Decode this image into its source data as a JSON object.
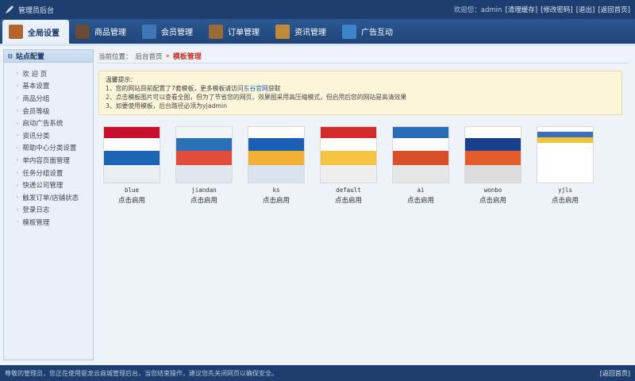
{
  "topbar": {
    "app_title": "管理员后台",
    "welcome": "欢迎您：admin",
    "links": [
      "[清理缓存]",
      "[修改密码]",
      "[退出]",
      "[返回首页]"
    ]
  },
  "nav": {
    "items": [
      {
        "label": "全局设置",
        "icon": "gear-house-icon",
        "color": "#b5642c",
        "active": true
      },
      {
        "label": "商品管理",
        "icon": "box-icon",
        "color": "#6b4a34"
      },
      {
        "label": "会员管理",
        "icon": "user-card-icon",
        "color": "#3c78b5"
      },
      {
        "label": "订单管理",
        "icon": "order-icon",
        "color": "#9b6a37"
      },
      {
        "label": "资讯管理",
        "icon": "news-icon",
        "color": "#c08a3a"
      },
      {
        "label": "广告互动",
        "icon": "ad-icon",
        "color": "#3f83c8"
      }
    ]
  },
  "sidebar": {
    "header": "站点配置",
    "items": [
      "欢 迎 页",
      "基本设置",
      "商品分组",
      "会员等级",
      "启动广告系统",
      "资讯分类",
      "帮助中心分类设置",
      "单内容页面管理",
      "任务分组设置",
      "快递公司管理",
      "触发订单/店铺状态",
      "登录日志",
      "模板管理"
    ]
  },
  "breadcrumb": {
    "prefix": "当前位置：",
    "home": "后台首页",
    "separator": "»",
    "current": "模板管理"
  },
  "notice": {
    "title": "温馨提示：",
    "line1_a": "1、您的网站目前配置了7套模板，更多模板请访问",
    "line1_link": "东谷官网",
    "line1_b": "获取",
    "line2": "2、点击模板图片可以查看全图，但为了节省您的网页，效果图采用高压缩模式，但启用后您的网站是高清效果",
    "line3": "3、如要使用模板，后台路径必须为yjadmin"
  },
  "themes": [
    {
      "name": "blue",
      "action": "点击启用",
      "colors": [
        "#c8102e",
        "#ffffff",
        "#1b64b3",
        "#e9eef5"
      ]
    },
    {
      "name": "jiandan",
      "action": "点击启用",
      "colors": [
        "#f1f4f8",
        "#2a6fb8",
        "#e24c3b",
        "#dfe6ee"
      ]
    },
    {
      "name": "ks",
      "action": "点击启用",
      "colors": [
        "#ffffff",
        "#1a5fb4",
        "#f2b134",
        "#d9e3ee"
      ]
    },
    {
      "name": "default",
      "action": "点击启用",
      "colors": [
        "#d22b2b",
        "#ffffff",
        "#f6c242",
        "#eeeeee"
      ]
    },
    {
      "name": "ai",
      "action": "点击启用",
      "colors": [
        "#2a6bb8",
        "#ffffff",
        "#d84f2a",
        "#e6e6e6"
      ]
    },
    {
      "name": "wonbo",
      "action": "点击启用",
      "colors": [
        "#ffffff",
        "#1a3f8f",
        "#e35a2b",
        "#dcdcdc"
      ]
    },
    {
      "name": "yjls",
      "action": "点击启用",
      "colors": [
        "#ffffff",
        "#3a6fc0",
        "#f0c23a",
        "#ffffff"
      ]
    }
  ],
  "footer": {
    "text": "尊敬的管理员，您正在使用驱龙云商城管理后台，当您结束操作，建议您先关闭网页以确保安全。",
    "back": "[返回首页]"
  }
}
